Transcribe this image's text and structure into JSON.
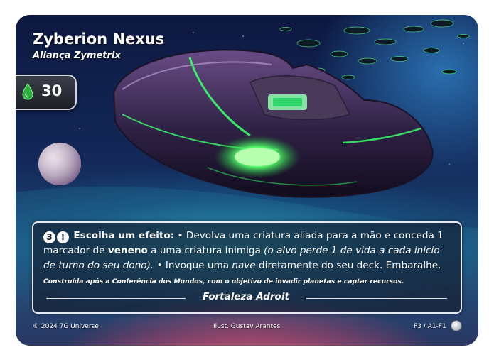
{
  "card": {
    "name": "Zyberion Nexus",
    "faction_line": "Aliança Zymetrix",
    "cost": "30",
    "cost_icon": "drop-icon",
    "rules": {
      "cost_badge": "3",
      "alert_badge": "!",
      "lead": "Escolha um efeito:",
      "p1": " • Devolva uma criatura aliada para a mão e conceda 1 marcador de ",
      "keyword_poison": "veneno",
      "p2": " a uma criatura inimiga ",
      "reminder": "(o alvo perde 1 de vida a cada início de turno do seu dono).",
      "p3": " • Invoque uma ",
      "keyword_ship": "nave",
      "p4": " diretamente do seu deck. Embaralhe.",
      "flavor": "Construída após a Conferência dos Mundos, com o objetivo de invadir planetas e captar recursos."
    },
    "set_name": "Fortaleza Adroit",
    "copyright": "© 2024 7G Universe",
    "illustrator": "Ilust. Gustav Arantes",
    "collector_number": "F3 / A1-F1"
  },
  "colors": {
    "accent_green": "#39ff6a",
    "cost_drop": "#2fae3f",
    "border": "#e6e9ef"
  }
}
